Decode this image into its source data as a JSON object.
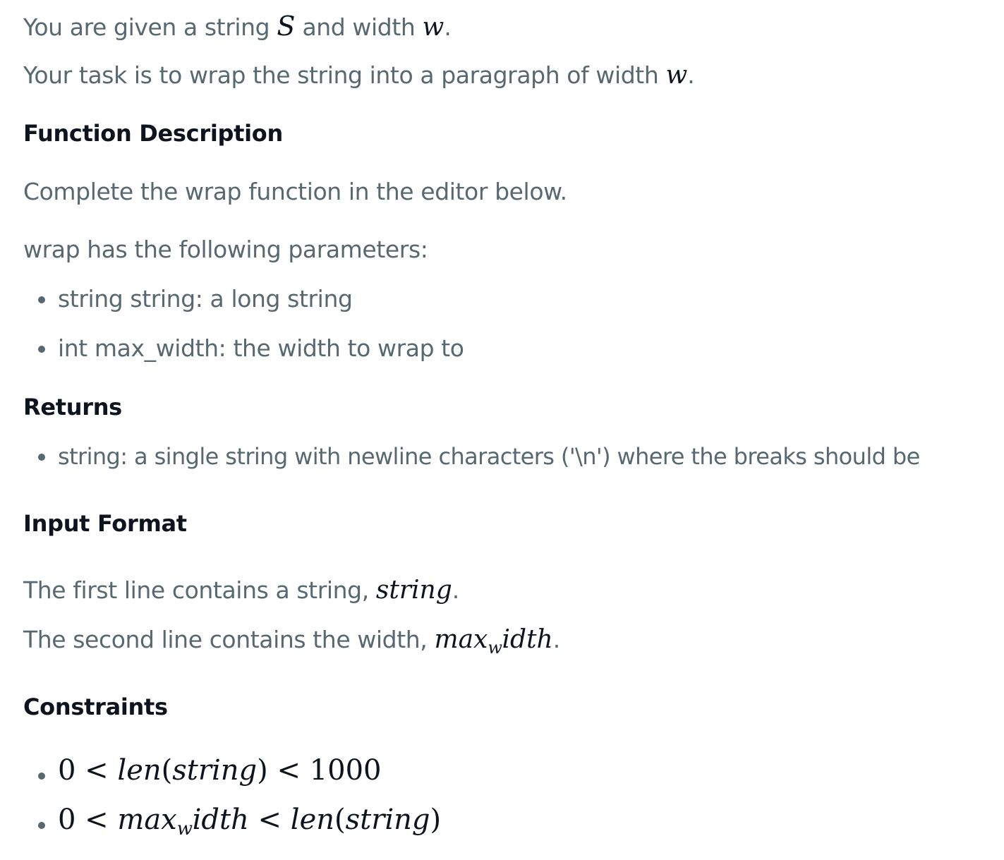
{
  "intro": {
    "line1_pre": "You are given a string ",
    "line1_var_s": "S",
    "line1_mid": " and width ",
    "line1_var_w": "w",
    "line1_end": ".",
    "line2_pre": "Your task is to wrap the string into a paragraph of width ",
    "line2_var_w": "w",
    "line2_end": "."
  },
  "function_description": {
    "heading": "Function Description",
    "text": "Complete the wrap function in the editor below.",
    "params_intro": "wrap has the following parameters:",
    "params": [
      "string string: a long string",
      "int max_width: the width to wrap to"
    ]
  },
  "returns": {
    "heading": "Returns",
    "items": [
      "string: a single string with newline characters ('\\n') where the breaks should be"
    ]
  },
  "input_format": {
    "heading": "Input Format",
    "line1_pre": "The first line contains a string, ",
    "line1_var": "string",
    "line1_end": ".",
    "line2_pre": "The second line contains the width, ",
    "line2_var_a": "max",
    "line2_var_sub": "w",
    "line2_var_b": "idth",
    "line2_end": "."
  },
  "constraints": {
    "heading": "Constraints",
    "c1": {
      "zero": "0",
      "lt1": " < ",
      "len": "len",
      "open": "(",
      "arg": "string",
      "close": ")",
      "lt2": " < ",
      "bound": "1000"
    },
    "c2": {
      "zero": "0",
      "lt1": " < ",
      "var_a": "max",
      "var_sub": "w",
      "var_b": "idth",
      "lt2": " < ",
      "len": "len",
      "open": "(",
      "arg": "string",
      "close": ")"
    }
  }
}
